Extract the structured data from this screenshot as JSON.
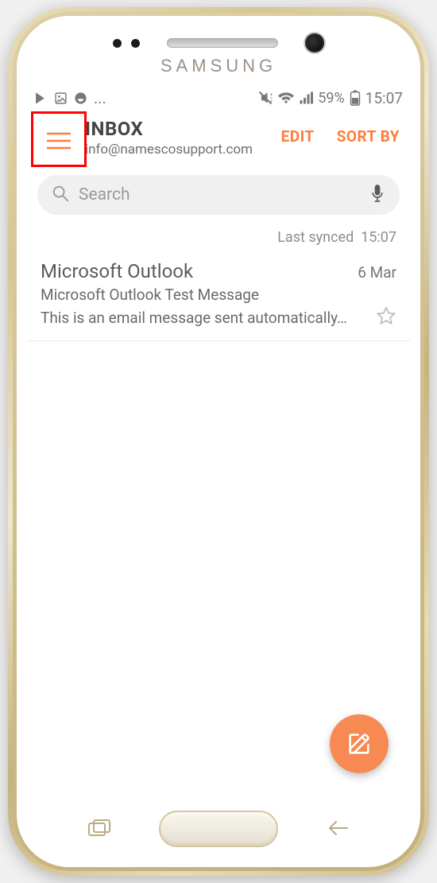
{
  "device": {
    "brand": "SAMSUNG"
  },
  "statusbar": {
    "ellipsis": "...",
    "battery_pct": "59%",
    "time": "15:07"
  },
  "header": {
    "title": "INBOX",
    "subtitle": "info@namescosupport.com",
    "edit_label": "EDIT",
    "sort_label": "SORT BY"
  },
  "search": {
    "placeholder": "Search"
  },
  "sync": {
    "label": "Last synced",
    "time": "15:07"
  },
  "emails": [
    {
      "sender": "Microsoft Outlook",
      "date": "6 Mar",
      "subject": "Microsoft Outlook Test Message",
      "preview": "This is an email message sent automatically…"
    }
  ],
  "colors": {
    "accent": "#ff7b3a",
    "fab": "#f78a53"
  }
}
